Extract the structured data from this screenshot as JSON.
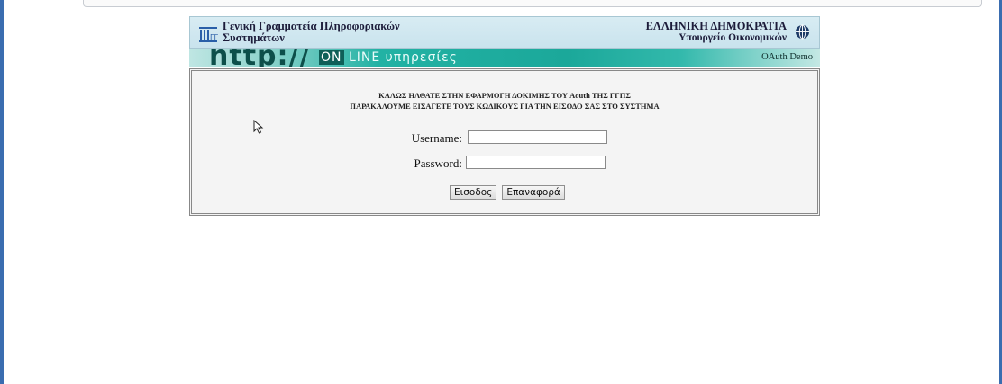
{
  "header": {
    "org_line1": "Γενική Γραμματεία Πληροφοριακών",
    "org_line2": "Συστημάτων",
    "country": "ΕΛΛΗΝΙΚΗ ΔΗΜΟΚΡΑΤΙΑ",
    "ministry": "Υπουργείο Οικονομικών",
    "logo_icon": "building-columns-icon",
    "globe_icon": "globe-icon"
  },
  "banner": {
    "http": "http://",
    "online_on": "ON",
    "online_rest": " LINE υπηρεσίες",
    "right_label": "OAuth Demo"
  },
  "content": {
    "welcome": "ΚΑΛΩΣ ΗΛΘΑΤΕ ΣΤΗΝ ΕΦΑΡΜΟΓΗ ΔΟΚΙΜΗΣ ΤΟΥ Aouth ΤΗΣ ΓΓΠΣ",
    "instruction": "ΠΑΡΑΚΑΛΟΥΜΕ ΕΙΣΑΓΕΤΕ ΤΟΥΣ ΚΩΔΙΚΟΥΣ ΓΙΑ ΤΗΝ ΕΙΣΟΔΟ ΣΑΣ ΣΤΟ ΣΥΣΤΗΜΑ",
    "username_label": "Username:",
    "username_value": "",
    "password_label": "Password:",
    "password_value": "",
    "login_button": "Εισοδος",
    "reset_button": "Επαναφορά"
  },
  "colors": {
    "header_bg": "#c9e3ed",
    "banner_teal": "#1ba89a",
    "window_border": "#3a6db0"
  }
}
